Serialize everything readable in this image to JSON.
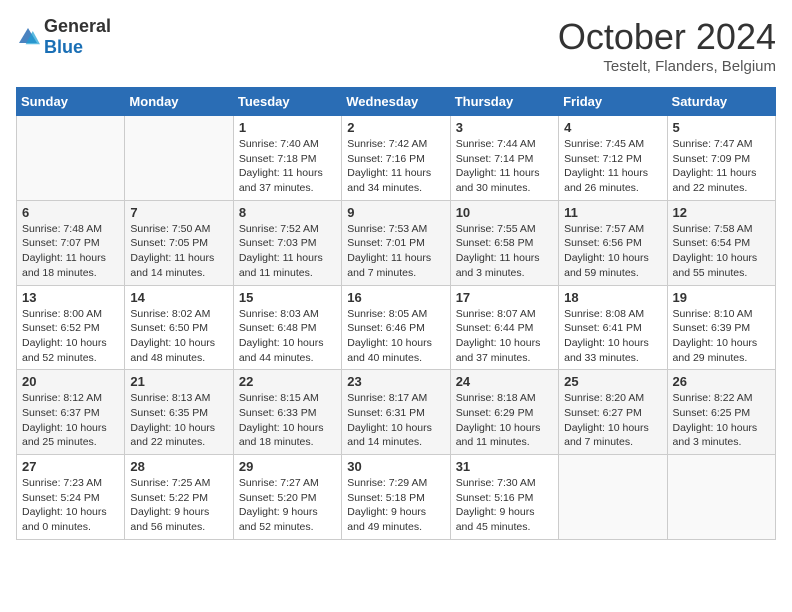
{
  "header": {
    "logo_general": "General",
    "logo_blue": "Blue",
    "month": "October 2024",
    "location": "Testelt, Flanders, Belgium"
  },
  "days_of_week": [
    "Sunday",
    "Monday",
    "Tuesday",
    "Wednesday",
    "Thursday",
    "Friday",
    "Saturday"
  ],
  "weeks": [
    [
      {
        "day": "",
        "sunrise": "",
        "sunset": "",
        "daylight": ""
      },
      {
        "day": "",
        "sunrise": "",
        "sunset": "",
        "daylight": ""
      },
      {
        "day": "1",
        "sunrise": "Sunrise: 7:40 AM",
        "sunset": "Sunset: 7:18 PM",
        "daylight": "Daylight: 11 hours and 37 minutes."
      },
      {
        "day": "2",
        "sunrise": "Sunrise: 7:42 AM",
        "sunset": "Sunset: 7:16 PM",
        "daylight": "Daylight: 11 hours and 34 minutes."
      },
      {
        "day": "3",
        "sunrise": "Sunrise: 7:44 AM",
        "sunset": "Sunset: 7:14 PM",
        "daylight": "Daylight: 11 hours and 30 minutes."
      },
      {
        "day": "4",
        "sunrise": "Sunrise: 7:45 AM",
        "sunset": "Sunset: 7:12 PM",
        "daylight": "Daylight: 11 hours and 26 minutes."
      },
      {
        "day": "5",
        "sunrise": "Sunrise: 7:47 AM",
        "sunset": "Sunset: 7:09 PM",
        "daylight": "Daylight: 11 hours and 22 minutes."
      }
    ],
    [
      {
        "day": "6",
        "sunrise": "Sunrise: 7:48 AM",
        "sunset": "Sunset: 7:07 PM",
        "daylight": "Daylight: 11 hours and 18 minutes."
      },
      {
        "day": "7",
        "sunrise": "Sunrise: 7:50 AM",
        "sunset": "Sunset: 7:05 PM",
        "daylight": "Daylight: 11 hours and 14 minutes."
      },
      {
        "day": "8",
        "sunrise": "Sunrise: 7:52 AM",
        "sunset": "Sunset: 7:03 PM",
        "daylight": "Daylight: 11 hours and 11 minutes."
      },
      {
        "day": "9",
        "sunrise": "Sunrise: 7:53 AM",
        "sunset": "Sunset: 7:01 PM",
        "daylight": "Daylight: 11 hours and 7 minutes."
      },
      {
        "day": "10",
        "sunrise": "Sunrise: 7:55 AM",
        "sunset": "Sunset: 6:58 PM",
        "daylight": "Daylight: 11 hours and 3 minutes."
      },
      {
        "day": "11",
        "sunrise": "Sunrise: 7:57 AM",
        "sunset": "Sunset: 6:56 PM",
        "daylight": "Daylight: 10 hours and 59 minutes."
      },
      {
        "day": "12",
        "sunrise": "Sunrise: 7:58 AM",
        "sunset": "Sunset: 6:54 PM",
        "daylight": "Daylight: 10 hours and 55 minutes."
      }
    ],
    [
      {
        "day": "13",
        "sunrise": "Sunrise: 8:00 AM",
        "sunset": "Sunset: 6:52 PM",
        "daylight": "Daylight: 10 hours and 52 minutes."
      },
      {
        "day": "14",
        "sunrise": "Sunrise: 8:02 AM",
        "sunset": "Sunset: 6:50 PM",
        "daylight": "Daylight: 10 hours and 48 minutes."
      },
      {
        "day": "15",
        "sunrise": "Sunrise: 8:03 AM",
        "sunset": "Sunset: 6:48 PM",
        "daylight": "Daylight: 10 hours and 44 minutes."
      },
      {
        "day": "16",
        "sunrise": "Sunrise: 8:05 AM",
        "sunset": "Sunset: 6:46 PM",
        "daylight": "Daylight: 10 hours and 40 minutes."
      },
      {
        "day": "17",
        "sunrise": "Sunrise: 8:07 AM",
        "sunset": "Sunset: 6:44 PM",
        "daylight": "Daylight: 10 hours and 37 minutes."
      },
      {
        "day": "18",
        "sunrise": "Sunrise: 8:08 AM",
        "sunset": "Sunset: 6:41 PM",
        "daylight": "Daylight: 10 hours and 33 minutes."
      },
      {
        "day": "19",
        "sunrise": "Sunrise: 8:10 AM",
        "sunset": "Sunset: 6:39 PM",
        "daylight": "Daylight: 10 hours and 29 minutes."
      }
    ],
    [
      {
        "day": "20",
        "sunrise": "Sunrise: 8:12 AM",
        "sunset": "Sunset: 6:37 PM",
        "daylight": "Daylight: 10 hours and 25 minutes."
      },
      {
        "day": "21",
        "sunrise": "Sunrise: 8:13 AM",
        "sunset": "Sunset: 6:35 PM",
        "daylight": "Daylight: 10 hours and 22 minutes."
      },
      {
        "day": "22",
        "sunrise": "Sunrise: 8:15 AM",
        "sunset": "Sunset: 6:33 PM",
        "daylight": "Daylight: 10 hours and 18 minutes."
      },
      {
        "day": "23",
        "sunrise": "Sunrise: 8:17 AM",
        "sunset": "Sunset: 6:31 PM",
        "daylight": "Daylight: 10 hours and 14 minutes."
      },
      {
        "day": "24",
        "sunrise": "Sunrise: 8:18 AM",
        "sunset": "Sunset: 6:29 PM",
        "daylight": "Daylight: 10 hours and 11 minutes."
      },
      {
        "day": "25",
        "sunrise": "Sunrise: 8:20 AM",
        "sunset": "Sunset: 6:27 PM",
        "daylight": "Daylight: 10 hours and 7 minutes."
      },
      {
        "day": "26",
        "sunrise": "Sunrise: 8:22 AM",
        "sunset": "Sunset: 6:25 PM",
        "daylight": "Daylight: 10 hours and 3 minutes."
      }
    ],
    [
      {
        "day": "27",
        "sunrise": "Sunrise: 7:23 AM",
        "sunset": "Sunset: 5:24 PM",
        "daylight": "Daylight: 10 hours and 0 minutes."
      },
      {
        "day": "28",
        "sunrise": "Sunrise: 7:25 AM",
        "sunset": "Sunset: 5:22 PM",
        "daylight": "Daylight: 9 hours and 56 minutes."
      },
      {
        "day": "29",
        "sunrise": "Sunrise: 7:27 AM",
        "sunset": "Sunset: 5:20 PM",
        "daylight": "Daylight: 9 hours and 52 minutes."
      },
      {
        "day": "30",
        "sunrise": "Sunrise: 7:29 AM",
        "sunset": "Sunset: 5:18 PM",
        "daylight": "Daylight: 9 hours and 49 minutes."
      },
      {
        "day": "31",
        "sunrise": "Sunrise: 7:30 AM",
        "sunset": "Sunset: 5:16 PM",
        "daylight": "Daylight: 9 hours and 45 minutes."
      },
      {
        "day": "",
        "sunrise": "",
        "sunset": "",
        "daylight": ""
      },
      {
        "day": "",
        "sunrise": "",
        "sunset": "",
        "daylight": ""
      }
    ]
  ]
}
